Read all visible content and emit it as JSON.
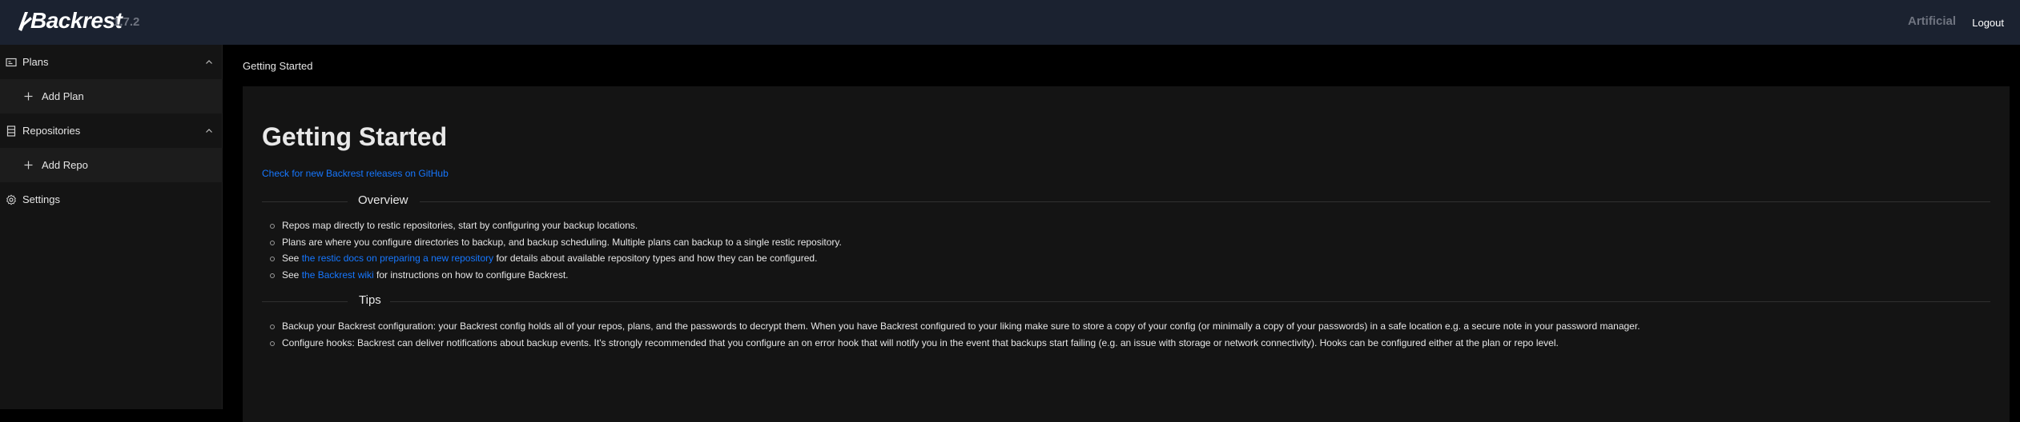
{
  "header": {
    "app_name": "Backrest",
    "version": "1.7.2",
    "instance_name": "Artificial",
    "logout_label": "Logout"
  },
  "sidebar": {
    "items": [
      {
        "label": "Plans",
        "icon": "plans-icon"
      },
      {
        "label": "Add Plan",
        "icon": "plus-icon"
      },
      {
        "label": "Repositories",
        "icon": "database-icon"
      },
      {
        "label": "Add Repo",
        "icon": "plus-icon"
      },
      {
        "label": "Settings",
        "icon": "gear-icon"
      }
    ]
  },
  "breadcrumb": "Getting Started",
  "main": {
    "title": "Getting Started",
    "release_link": "Check for new Backrest releases on GitHub",
    "overview": {
      "heading": "Overview",
      "items": [
        {
          "text": "Repos map directly to restic repositories, start by configuring your backup locations."
        },
        {
          "text": "Plans are where you configure directories to backup, and backup scheduling. Multiple plans can backup to a single restic repository."
        },
        {
          "pre": "See ",
          "link": "the restic docs on preparing a new repository",
          "post": " for details about available repository types and how they can be configured."
        },
        {
          "pre": "See ",
          "link": "the Backrest wiki",
          "post": " for instructions on how to configure Backrest."
        }
      ]
    },
    "tips": {
      "heading": "Tips",
      "items": [
        {
          "text": "Backup your Backrest configuration: your Backrest config holds all of your repos, plans, and the passwords to decrypt them. When you have Backrest configured to your liking make sure to store a copy of your config (or minimally a copy of your passwords) in a safe location e.g. a secure note in your password manager."
        },
        {
          "text": "Configure hooks: Backrest can deliver notifications about backup events. It's strongly recommended that you configure an on error hook that will notify you in the event that backups start failing (e.g. an issue with storage or network connectivity). Hooks can be configured either at the plan or repo level."
        }
      ]
    }
  },
  "colors": {
    "header_bg": "#1b2230",
    "link": "#1677ff",
    "sidebar_bg": "#141414",
    "card_bg": "#141414"
  }
}
